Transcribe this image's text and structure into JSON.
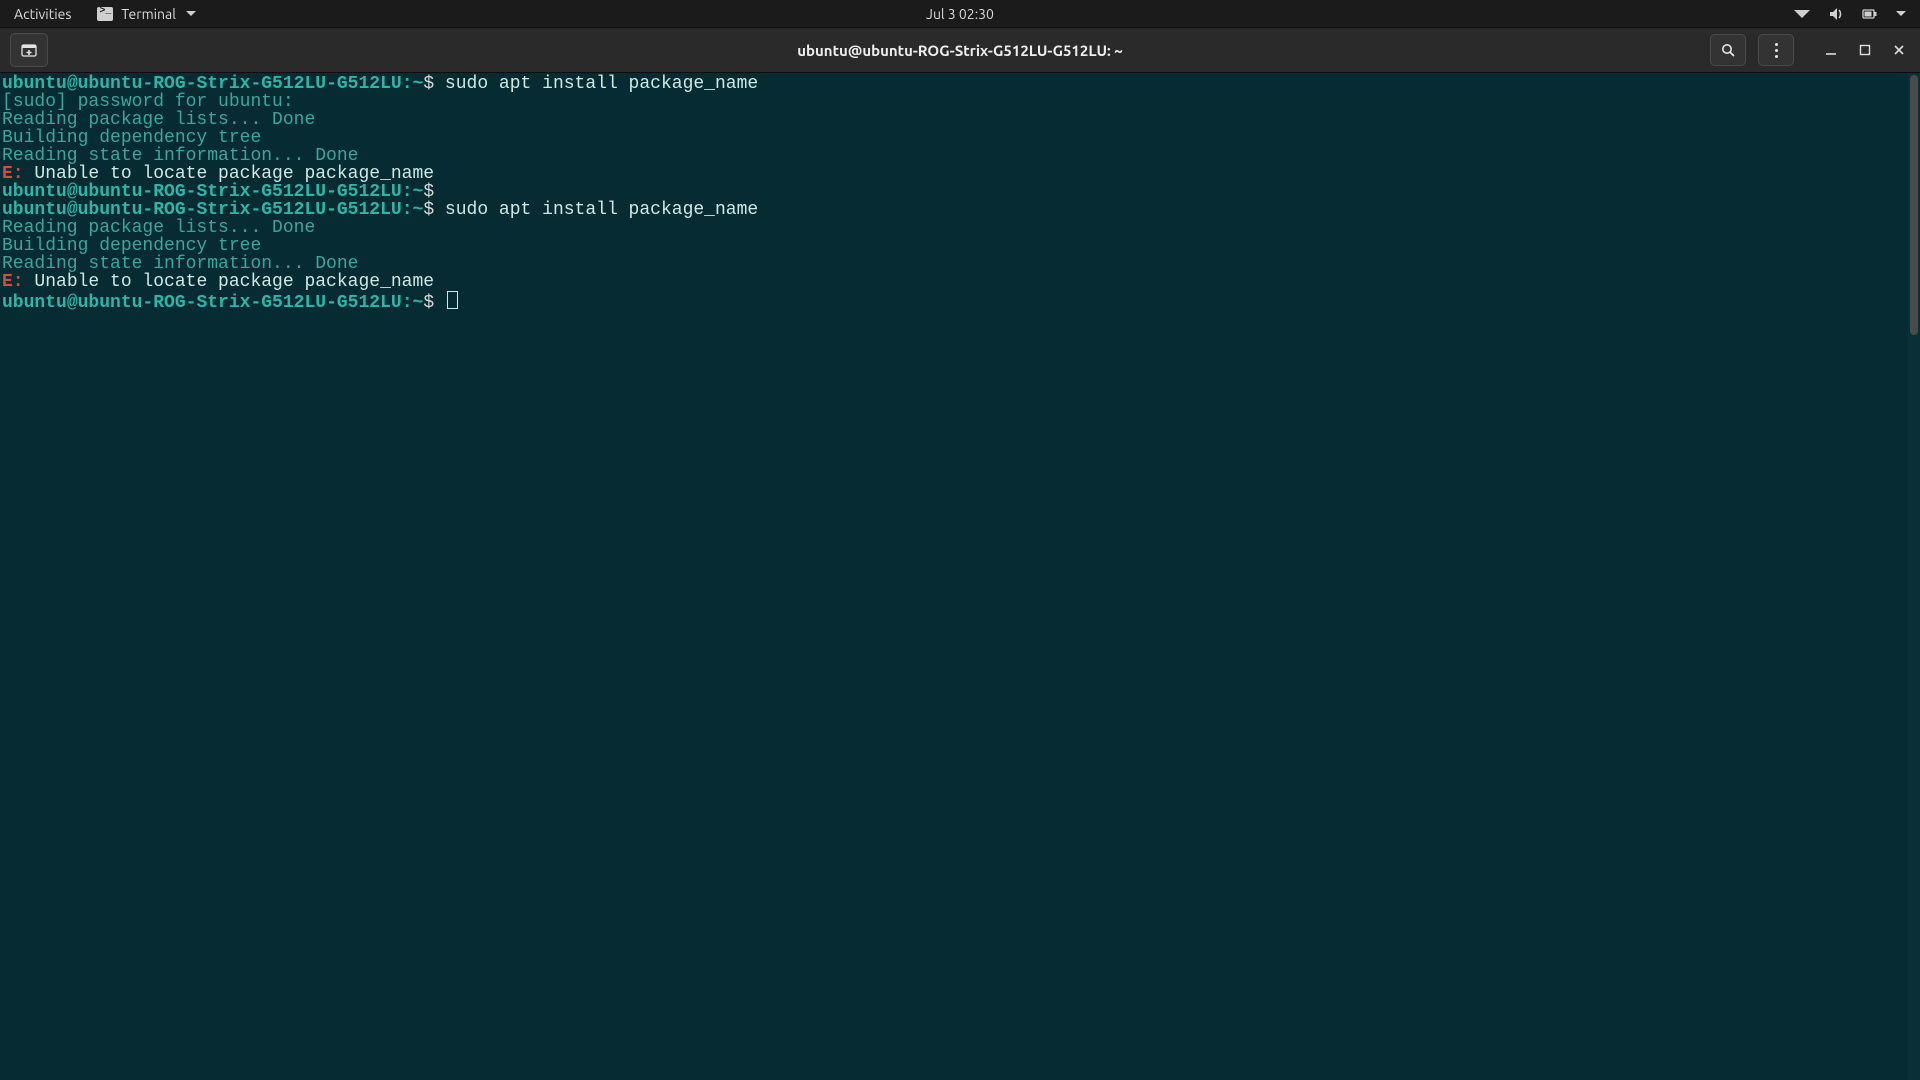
{
  "topbar": {
    "activities": "Activities",
    "app_menu_label": "Terminal",
    "clock": "Jul 3  02:30"
  },
  "headerbar": {
    "title": "ubuntu@ubuntu-ROG-Strix-G512LU-G512LU: ~"
  },
  "prompt": {
    "user": "ubuntu",
    "at": "@",
    "host": "ubuntu-ROG-Strix-G512LU-G512LU",
    "colon": ":",
    "path": "~",
    "dollar": "$"
  },
  "lines": {
    "cmd1": " sudo apt install package_name",
    "out1": "[sudo] password for ubuntu:",
    "out2": "Reading package lists... Done",
    "out3": "Building dependency tree",
    "out4": "Reading state information... Done",
    "errE": "E:",
    "errMsg": " Unable to locate package package_name",
    "cmd_blank": " ",
    "cmd2": " sudo apt install package_name"
  },
  "colors": {
    "bg_panel": "#1b1b1b",
    "bg_header": "#2a2a2a",
    "bg_term": "#062b33",
    "fg_prompt": "#2fb5a7",
    "fg_text": "#cfe8e3",
    "fg_error": "#d24d3a"
  },
  "icons": {
    "new_tab": "new-tab-icon",
    "search": "search-icon",
    "menu": "menu-icon",
    "minimize": "minimize-icon",
    "maximize": "maximize-icon",
    "close": "close-icon",
    "network": "network-icon",
    "volume": "volume-icon",
    "battery": "battery-icon",
    "power": "power-menu-chevron-icon"
  }
}
